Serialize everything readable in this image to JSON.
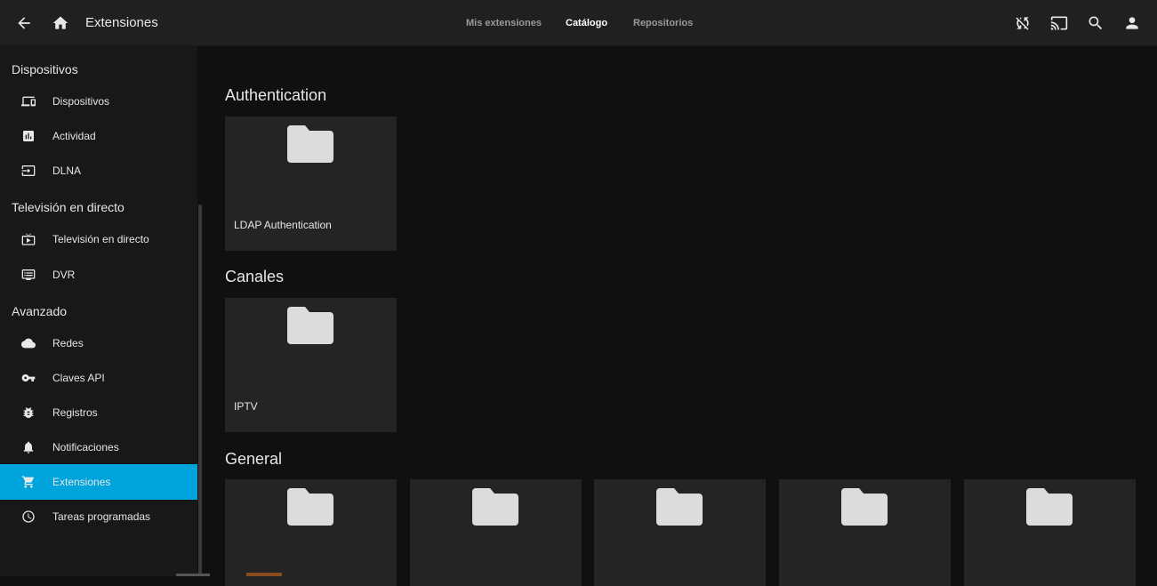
{
  "header": {
    "title": "Extensiones",
    "tabs": [
      {
        "label": "Mis extensiones",
        "active": false
      },
      {
        "label": "Catálogo",
        "active": true
      },
      {
        "label": "Repositorios",
        "active": false
      }
    ],
    "icons": [
      "back-arrow-icon",
      "home-icon",
      "sync-disabled-icon",
      "cast-icon",
      "search-icon",
      "user-icon"
    ]
  },
  "sidebar": {
    "sections": [
      {
        "title": "Dispositivos",
        "items": [
          {
            "label": "Dispositivos",
            "icon": "devices-icon"
          },
          {
            "label": "Actividad",
            "icon": "assessment-icon"
          },
          {
            "label": "DLNA",
            "icon": "input-icon"
          }
        ]
      },
      {
        "title": "Televisión en directo",
        "items": [
          {
            "label": "Televisión en directo",
            "icon": "live-tv-icon"
          },
          {
            "label": "DVR",
            "icon": "dvr-icon"
          }
        ]
      },
      {
        "title": "Avanzado",
        "items": [
          {
            "label": "Redes",
            "icon": "cloud-icon"
          },
          {
            "label": "Claves API",
            "icon": "vpn-key-icon"
          },
          {
            "label": "Registros",
            "icon": "bug-icon"
          },
          {
            "label": "Notificaciones",
            "icon": "bell-icon"
          },
          {
            "label": "Extensiones",
            "icon": "cart-icon",
            "active": true
          },
          {
            "label": "Tareas programadas",
            "icon": "schedule-icon"
          }
        ]
      }
    ],
    "active_color": "#00a4dc"
  },
  "catalog": [
    {
      "category": "Authentication",
      "plugins": [
        "LDAP Authentication"
      ]
    },
    {
      "category": "Canales",
      "plugins": [
        "IPTV"
      ]
    },
    {
      "category": "General",
      "plugins": [
        "",
        "",
        "",
        "",
        ""
      ]
    }
  ]
}
